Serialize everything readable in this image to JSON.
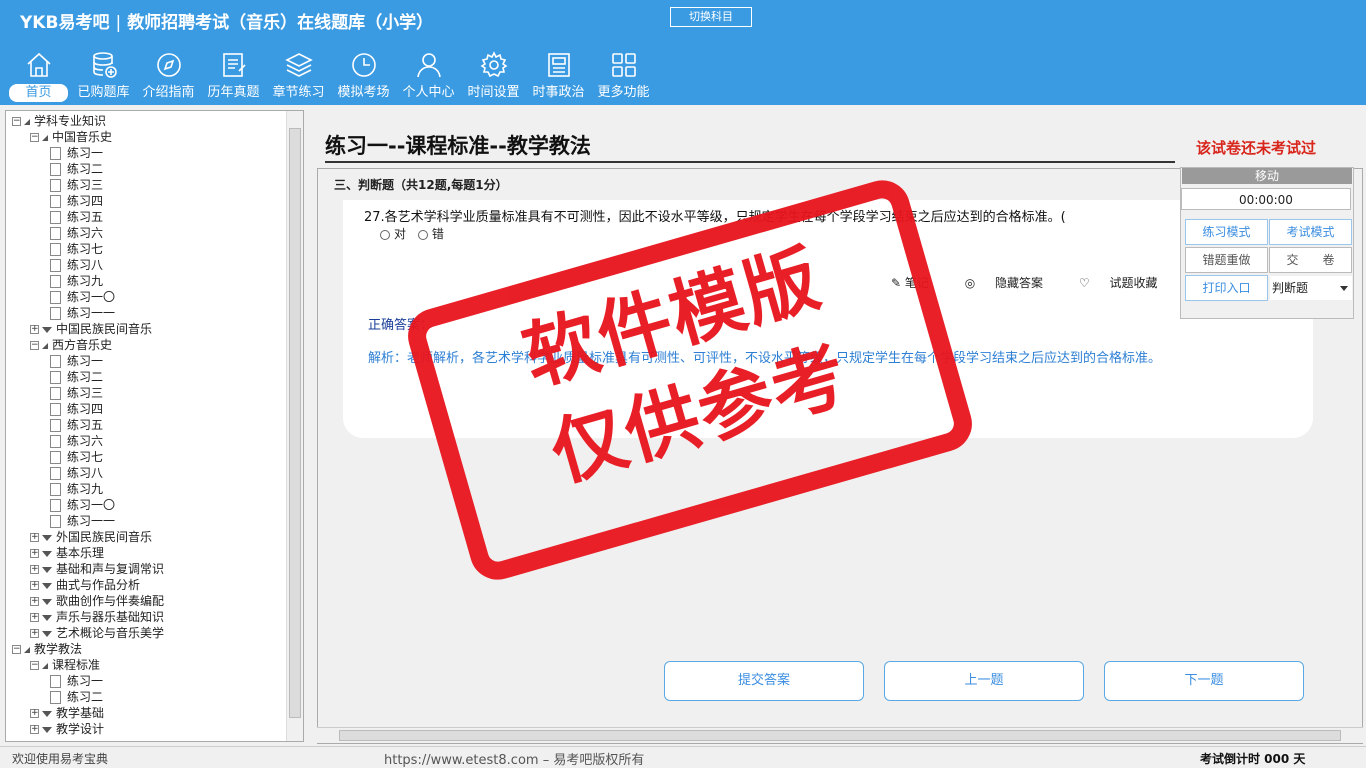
{
  "app": {
    "brand": "YKB易考吧",
    "title": "教师招聘考试（音乐）在线题库（小学）",
    "switch_subject": "切换科目"
  },
  "nav": [
    {
      "label": "首页",
      "icon": "home-icon",
      "active": true
    },
    {
      "label": "已购题库",
      "icon": "database-icon"
    },
    {
      "label": "介绍指南",
      "icon": "compass-icon"
    },
    {
      "label": "历年真题",
      "icon": "document-list-icon"
    },
    {
      "label": "章节练习",
      "icon": "layers-icon"
    },
    {
      "label": "模拟考场",
      "icon": "clock-icon"
    },
    {
      "label": "个人中心",
      "icon": "user-icon"
    },
    {
      "label": "时间设置",
      "icon": "gear-icon"
    },
    {
      "label": "时事政治",
      "icon": "newspaper-icon"
    },
    {
      "label": "更多功能",
      "icon": "grid-icon"
    }
  ],
  "tree": [
    {
      "label": "学科专业知识",
      "level": 0,
      "state": "open"
    },
    {
      "label": "中国音乐史",
      "level": 1,
      "state": "open"
    },
    {
      "label": "练习一",
      "level": 2
    },
    {
      "label": "练习二",
      "level": 2
    },
    {
      "label": "练习三",
      "level": 2
    },
    {
      "label": "练习四",
      "level": 2
    },
    {
      "label": "练习五",
      "level": 2
    },
    {
      "label": "练习六",
      "level": 2
    },
    {
      "label": "练习七",
      "level": 2
    },
    {
      "label": "练习八",
      "level": 2
    },
    {
      "label": "练习九",
      "level": 2
    },
    {
      "label": "练习一〇",
      "level": 2
    },
    {
      "label": "练习一一",
      "level": 2
    },
    {
      "label": "中国民族民间音乐",
      "level": 1,
      "state": "closed"
    },
    {
      "label": "西方音乐史",
      "level": 1,
      "state": "open"
    },
    {
      "label": "练习一",
      "level": 2
    },
    {
      "label": "练习二",
      "level": 2
    },
    {
      "label": "练习三",
      "level": 2
    },
    {
      "label": "练习四",
      "level": 2
    },
    {
      "label": "练习五",
      "level": 2
    },
    {
      "label": "练习六",
      "level": 2
    },
    {
      "label": "练习七",
      "level": 2
    },
    {
      "label": "练习八",
      "level": 2
    },
    {
      "label": "练习九",
      "level": 2
    },
    {
      "label": "练习一〇",
      "level": 2
    },
    {
      "label": "练习一一",
      "level": 2
    },
    {
      "label": "外国民族民间音乐",
      "level": 1,
      "state": "closed"
    },
    {
      "label": "基本乐理",
      "level": 1,
      "state": "closed"
    },
    {
      "label": "基础和声与复调常识",
      "level": 1,
      "state": "closed"
    },
    {
      "label": "曲式与作品分析",
      "level": 1,
      "state": "closed"
    },
    {
      "label": "歌曲创作与伴奏编配",
      "level": 1,
      "state": "closed"
    },
    {
      "label": "声乐与器乐基础知识",
      "level": 1,
      "state": "closed"
    },
    {
      "label": "艺术概论与音乐美学",
      "level": 1,
      "state": "closed"
    },
    {
      "label": "教学教法",
      "level": 0,
      "state": "open"
    },
    {
      "label": "课程标准",
      "level": 1,
      "state": "open"
    },
    {
      "label": "练习一",
      "level": 2
    },
    {
      "label": "练习二",
      "level": 2
    },
    {
      "label": "教学基础",
      "level": 1,
      "state": "closed"
    },
    {
      "label": "教学设计",
      "level": 1,
      "state": "closed"
    }
  ],
  "paper": {
    "title": "练习一--课程标准--教学教法",
    "status": "该试卷还未考试过",
    "section": "三、判断题（共12题,每题1分）"
  },
  "question": {
    "text": "27.各艺术学科学业质量标准具有不可测性，因此不设水平等级，只规定学生在每个学段学习结束之后应达到的合格标准。(",
    "option_true": "对",
    "option_false": "错",
    "correct": "正确答案：",
    "analysis": "解析：老师解析，各艺术学科学业质量标准具有可测性、可评性，不设水平等级，只规定学生在每个学段学习结束之后应达到的合格标准。"
  },
  "tools": {
    "notes": "笔记",
    "hide_answer": "隐藏答案",
    "favorite": "试题收藏",
    "error": "错题"
  },
  "buttons": {
    "submit": "提交答案",
    "prev": "上一题",
    "next": "下一题"
  },
  "side": {
    "move": "移动",
    "timer": "00:00:00",
    "practice_mode": "练习模式",
    "exam_mode": "考试模式",
    "redo_wrong": "错题重做",
    "hand_in": "交　　卷",
    "print": "打印入口",
    "question_type": "判断题"
  },
  "status": {
    "welcome": "欢迎使用易考宝典",
    "url": "https://www.etest8.com – 易考吧版权所有",
    "countdown": "考试倒计时 000 天"
  },
  "watermark": {
    "line1": "软件模版",
    "line2": "仅供参考"
  }
}
